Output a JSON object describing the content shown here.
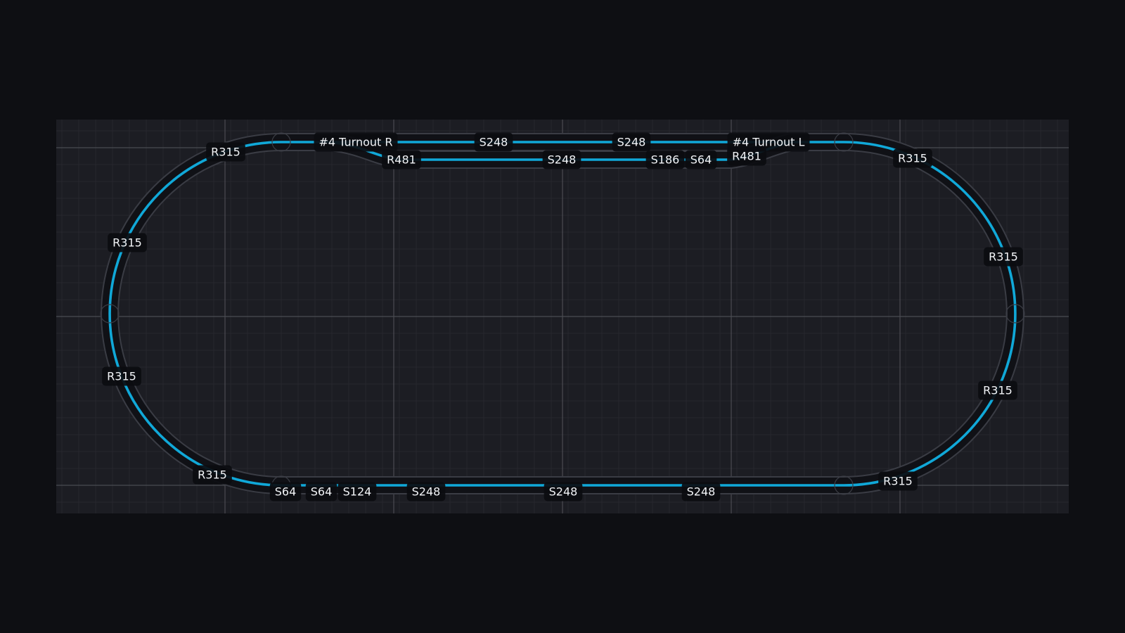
{
  "colors": {
    "page_bg": "#0e0f13",
    "grid_bg": "#1c1d23",
    "grid_minor": "#26272e",
    "grid_major": "#4a4b52",
    "track_bed": "#101116",
    "track_edge": "#3a3c44",
    "rail": "#10a8d8",
    "label_bg": "#0b0c10",
    "label_text": "#f2f4f7"
  },
  "pieces": {
    "top_left_curve": "R315",
    "left_upper": "R315",
    "left_lower": "R315",
    "bottom_left_curve": "R315",
    "top_right_curve": "R315",
    "right_upper": "R315",
    "right_lower": "R315",
    "bottom_right_curve": "R315",
    "turnout_right": "#4 Turnout R",
    "turnout_left": "#4 Turnout L",
    "main_straight_1": "S248",
    "main_straight_2": "S248",
    "siding_curve_left": "R481",
    "siding_straight_1": "S248",
    "siding_straight_2": "S186",
    "siding_straight_3": "S64",
    "siding_curve_right": "R481",
    "bottom_straight_1": "S64",
    "bottom_straight_2": "S64",
    "bottom_straight_3": "S124",
    "bottom_straight_4": "S248",
    "bottom_straight_5": "S248",
    "bottom_straight_6": "S248"
  }
}
